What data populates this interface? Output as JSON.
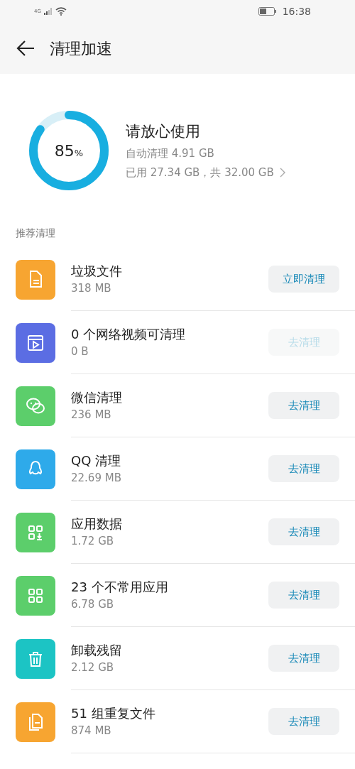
{
  "status_bar": {
    "network": "4G",
    "time": "16:38"
  },
  "header": {
    "title": "清理加速"
  },
  "storage": {
    "level": 0.85,
    "percent": "85",
    "percent_sign": "%",
    "headline": "请放心使用",
    "auto_clean": "自动清理 4.91 GB",
    "usage": "已用 27.34 GB，共 32.00 GB"
  },
  "section_title": "推荐清理",
  "items": [
    {
      "kind": "file",
      "color": "#f7a531",
      "title": "垃圾文件",
      "size": "318 MB",
      "button": "立即清理",
      "disabled": false
    },
    {
      "kind": "video",
      "color": "#5b6de3",
      "title": "0 个网络视频可清理",
      "size": "0 B",
      "button": "去清理",
      "disabled": true
    },
    {
      "kind": "chat",
      "color": "#5cce6b",
      "title": "微信清理",
      "size": "236 MB",
      "button": "去清理",
      "disabled": false
    },
    {
      "kind": "penguin",
      "color": "#2eaaea",
      "title": "QQ 清理",
      "size": "22.69 MB",
      "button": "去清理",
      "disabled": false
    },
    {
      "kind": "appdata",
      "color": "#5cce6b",
      "title": "应用数据",
      "size": "1.72 GB",
      "button": "去清理",
      "disabled": false
    },
    {
      "kind": "apps",
      "color": "#5cce6b",
      "title": "23 个不常用应用",
      "size": "6.78 GB",
      "button": "去清理",
      "disabled": false
    },
    {
      "kind": "trash",
      "color": "#1cc4c4",
      "title": "卸载残留",
      "size": "2.12 GB",
      "button": "去清理",
      "disabled": false
    },
    {
      "kind": "files",
      "color": "#f7a531",
      "title": "51 组重复文件",
      "size": "874 MB",
      "button": "去清理",
      "disabled": false
    }
  ]
}
